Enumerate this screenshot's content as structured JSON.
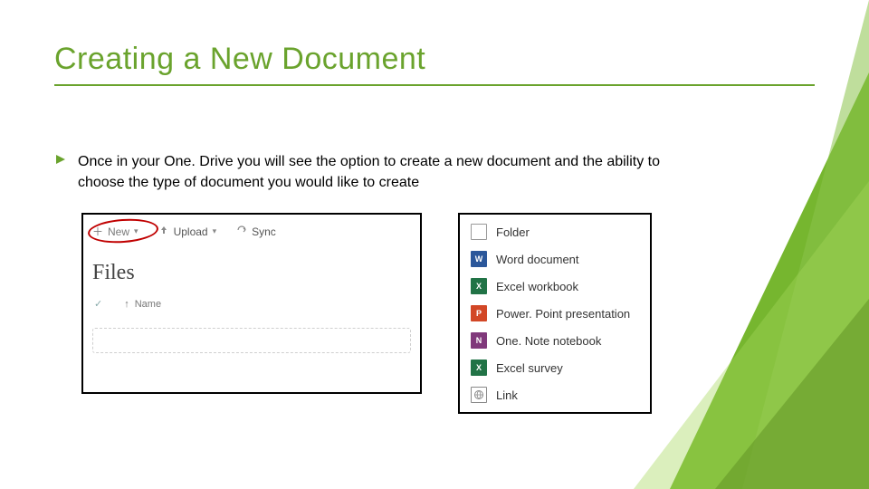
{
  "title": "Creating a New Document",
  "bullet": {
    "text_before": "Once in your ",
    "bold": "One. Drive",
    "text_after": " you will see the option to create a new document and the ability to choose the type of document you would like to create"
  },
  "toolbar": {
    "new_label": "New",
    "upload_label": "Upload",
    "sync_label": "Sync"
  },
  "files": {
    "heading": "Files",
    "name_col": "Name"
  },
  "menu": {
    "folder": "Folder",
    "word": "Word document",
    "excel": "Excel workbook",
    "ppt": "Power. Point presentation",
    "onenote": "One. Note notebook",
    "survey": "Excel survey",
    "link": "Link"
  },
  "icons": {
    "word": "W",
    "excel": "X",
    "ppt": "P",
    "note": "N",
    "survey": "X"
  }
}
